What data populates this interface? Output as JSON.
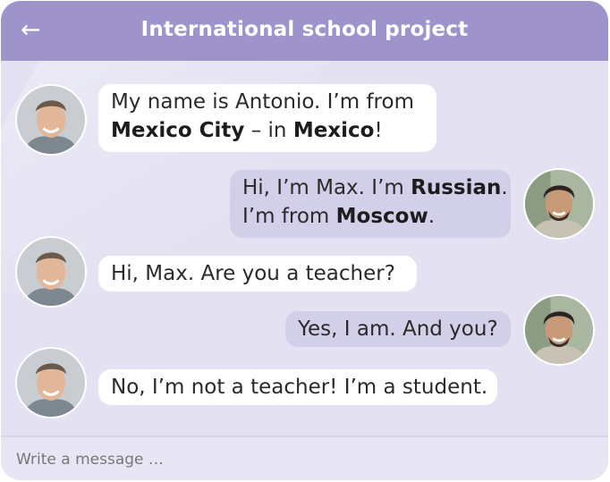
{
  "header": {
    "title": "International school project",
    "back_icon": "back-arrow-icon"
  },
  "messages": [
    {
      "sender": "Antonio",
      "side": "incoming",
      "line1": "My name is Antonio. I’m from",
      "line2_bold1": "Mexico City",
      "line2_plain1": " – in ",
      "line2_bold2": "Mexico",
      "line2_plain2": "!"
    },
    {
      "sender": "Max",
      "side": "outgoing",
      "line1_plain": "Hi, I’m Max. I’m ",
      "line1_bold": "Russian",
      "line1_end": ".",
      "line2_plain": "I’m from ",
      "line2_bold": "Moscow",
      "line2_end": "."
    },
    {
      "sender": "Antonio",
      "side": "incoming",
      "text": "Hi, Max. Are you a teacher?"
    },
    {
      "sender": "Max",
      "side": "outgoing",
      "text": "Yes, I am. And you?"
    },
    {
      "sender": "Antonio",
      "side": "incoming",
      "text": "No, I’m not a teacher! I’m a student."
    }
  ],
  "composer": {
    "placeholder": "Write a message …"
  },
  "colors": {
    "header": "#9f93cb",
    "chat_background": "#e3e1f2",
    "incoming_bubble": "#ffffff",
    "outgoing_bubble": "#d2cfe8"
  }
}
